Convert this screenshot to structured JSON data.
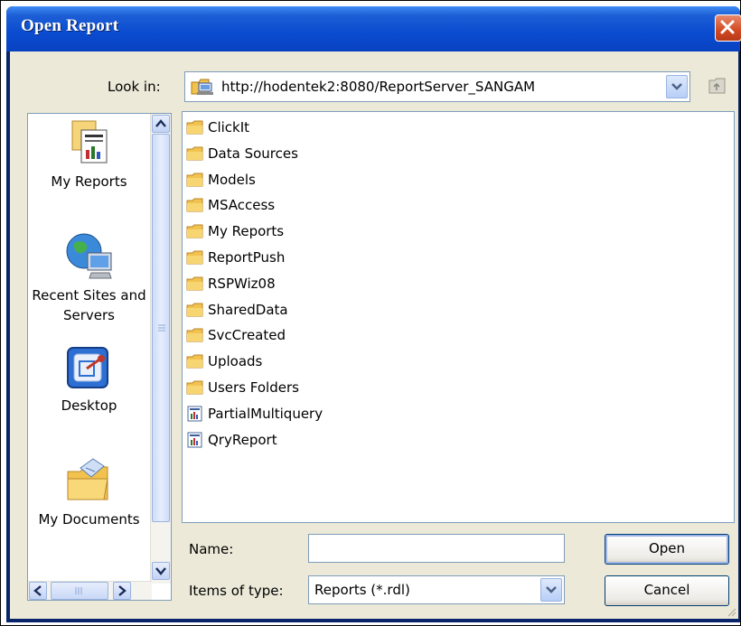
{
  "window": {
    "title": "Open Report"
  },
  "lookin": {
    "label": "Look in:",
    "value": "http://hodentek2:8080/ReportServer_SANGAM"
  },
  "places": [
    {
      "label": "My Reports"
    },
    {
      "label": "Recent Sites and Servers"
    },
    {
      "label": "Desktop"
    },
    {
      "label": "My Documents"
    }
  ],
  "items": [
    {
      "label": "ClickIt",
      "kind": "folder"
    },
    {
      "label": "Data Sources",
      "kind": "folder"
    },
    {
      "label": "Models",
      "kind": "folder"
    },
    {
      "label": "MSAccess",
      "kind": "folder"
    },
    {
      "label": "My Reports",
      "kind": "folder"
    },
    {
      "label": "ReportPush",
      "kind": "folder"
    },
    {
      "label": "RSPWiz08",
      "kind": "folder"
    },
    {
      "label": "SharedData",
      "kind": "folder"
    },
    {
      "label": "SvcCreated",
      "kind": "folder"
    },
    {
      "label": "Uploads",
      "kind": "folder"
    },
    {
      "label": "Users Folders",
      "kind": "folder"
    },
    {
      "label": "PartialMultiquery",
      "kind": "report"
    },
    {
      "label": "QryReport",
      "kind": "report"
    }
  ],
  "form": {
    "name_label": "Name:",
    "name_value": "",
    "type_label": "Items of type:",
    "type_value": "Reports (*.rdl)"
  },
  "buttons": {
    "open": "Open",
    "cancel": "Cancel"
  },
  "colors": {
    "titlebar": "#0a4bd0",
    "dialog_bg": "#ece9d8",
    "close": "#d14a22"
  }
}
